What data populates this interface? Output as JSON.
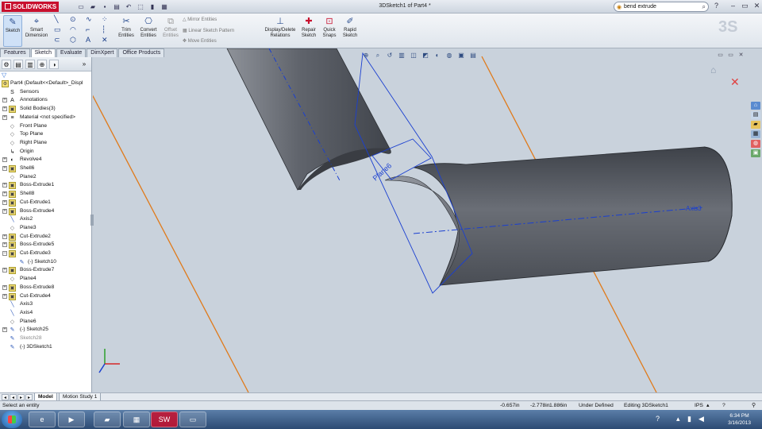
{
  "app": {
    "brand": "SOLIDWORKS",
    "document_title": "3DSketch1 of Part4 *",
    "search_text": "bend extrude",
    "help_label": "?"
  },
  "command_manager": {
    "sketch": "Sketch",
    "smart_dimension": "Smart Dimension",
    "trim_entities": "Trim Entities",
    "convert_entities": "Convert Entities",
    "offset_entities": "Offset Entities",
    "mirror_entities": "Mirror Entities",
    "linear_sketch_pattern": "Linear Sketch Pattern",
    "move_entities": "Move Entities",
    "display_delete_relations": "Display/Delete Relations",
    "repair_sketch": "Repair Sketch",
    "quick_snaps": "Quick Snaps",
    "rapid_sketch": "Rapid Sketch"
  },
  "tabs": [
    "Features",
    "Sketch",
    "Evaluate",
    "DimXpert",
    "Office Products"
  ],
  "active_tab": "Sketch",
  "tree": {
    "root": "Part4  (Default<<Default>_Displ",
    "items": [
      {
        "label": "Sensors",
        "icon": "S"
      },
      {
        "label": "Annotations",
        "icon": "A"
      },
      {
        "label": "Solid Bodies(3)",
        "icon": "▣"
      },
      {
        "label": "Material <not specified>",
        "icon": "≡"
      },
      {
        "label": "Front Plane",
        "icon": "◇"
      },
      {
        "label": "Top Plane",
        "icon": "◇"
      },
      {
        "label": "Right Plane",
        "icon": "◇"
      },
      {
        "label": "Origin",
        "icon": "↳"
      },
      {
        "label": "Revolve4",
        "icon": "◐"
      },
      {
        "label": "Shell6",
        "icon": "▣"
      },
      {
        "label": "Plane2",
        "icon": "◇"
      },
      {
        "label": "Boss-Extrude1",
        "icon": "▣"
      },
      {
        "label": "Shell8",
        "icon": "▣"
      },
      {
        "label": "Cut-Extrude1",
        "icon": "▣"
      },
      {
        "label": "Boss-Extrude4",
        "icon": "▣"
      },
      {
        "label": "Axis2",
        "icon": "╲"
      },
      {
        "label": "Plane3",
        "icon": "◇"
      },
      {
        "label": "Cut-Extrude2",
        "icon": "▣"
      },
      {
        "label": "Boss-Extrude5",
        "icon": "▣"
      },
      {
        "label": "Cut-Extrude3",
        "icon": "▣"
      },
      {
        "label": "(-) Sketch10",
        "icon": "✎"
      },
      {
        "label": "Boss-Extrude7",
        "icon": "▣"
      },
      {
        "label": "Plane4",
        "icon": "◇"
      },
      {
        "label": "Boss-Extrude8",
        "icon": "▣"
      },
      {
        "label": "Cut-Extrude4",
        "icon": "▣"
      },
      {
        "label": "Axis3",
        "icon": "╲"
      },
      {
        "label": "Axis4",
        "icon": "╲"
      },
      {
        "label": "Plane6",
        "icon": "◇"
      },
      {
        "label": "(-) Sketch25",
        "icon": "✎"
      },
      {
        "label": "Sketch28",
        "icon": "✎"
      },
      {
        "label": "(-) 3DSketch1",
        "icon": "✎"
      }
    ]
  },
  "bottom_tabs": [
    "Model",
    "Motion Study 1"
  ],
  "viewport": {
    "plane_label": "Plane6",
    "axis_label": "Axis3"
  },
  "status": {
    "hint": "Select an entity",
    "x": "-0.657in",
    "y": "-2.778in",
    "z": "1.886in",
    "state": "Under Defined",
    "mode": "Editing 3DSketch1",
    "units": "IPS"
  },
  "taskbar": {
    "time": "6:34 PM",
    "date": "3/16/2013"
  },
  "colors": {
    "accent_red": "#c8102e",
    "sketch_blue": "#1a3fd0",
    "axis_orange": "#e07a1a",
    "body_gray": "#5f636b"
  }
}
